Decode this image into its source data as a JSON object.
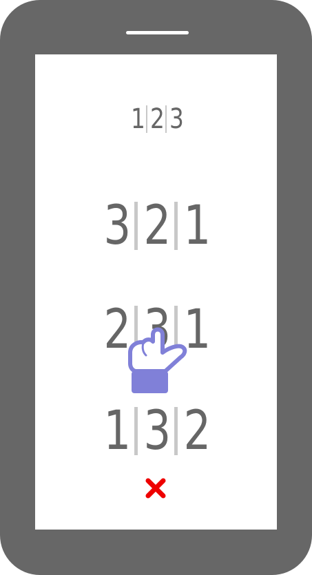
{
  "target": {
    "digits": [
      "1",
      "2",
      "3"
    ]
  },
  "options": [
    {
      "digits": [
        "3",
        "2",
        "1"
      ]
    },
    {
      "digits": [
        "2",
        "3",
        "1"
      ]
    },
    {
      "digits": [
        "1",
        "3",
        "2"
      ]
    }
  ],
  "icons": {
    "pointer": "pointing-hand-icon",
    "feedback": "wrong-x-icon"
  },
  "colors": {
    "device": "#676767",
    "screen": "#ffffff",
    "digit": "#666666",
    "separator": "#c8c8c8",
    "hand": "#8080d8",
    "wrong": "#ee0000"
  }
}
